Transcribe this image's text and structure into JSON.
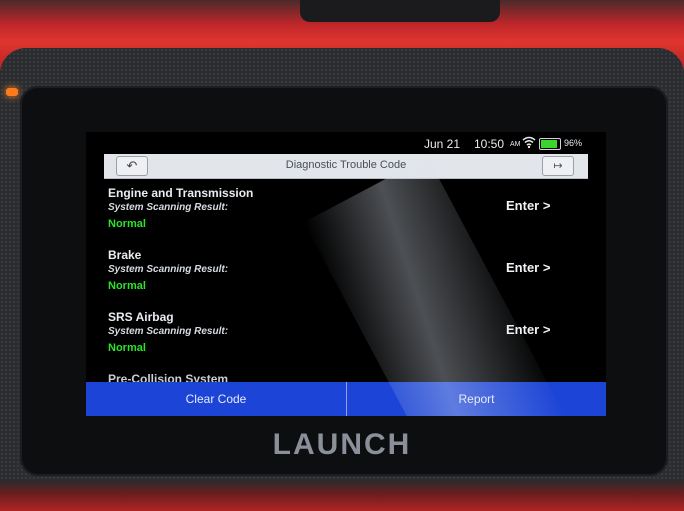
{
  "status_bar": {
    "date": "Jun 21",
    "time": "10:50",
    "ampm": "AM",
    "battery": "96%",
    "wifi_icon": "wifi-icon",
    "battery_level": 0.96,
    "battery_color": "#3ad52d"
  },
  "header": {
    "title": "Diagnostic Trouble Code",
    "back_icon": "back-arrow-icon",
    "exit_icon": "exit-icon"
  },
  "systems": [
    {
      "name": "Engine and Transmission",
      "subtitle": "System Scanning Result:",
      "status": "Normal",
      "action": "Enter >"
    },
    {
      "name": "Brake",
      "subtitle": "System Scanning Result:",
      "status": "Normal",
      "action": "Enter >"
    },
    {
      "name": "SRS Airbag",
      "subtitle": "System Scanning Result:",
      "status": "Normal",
      "action": "Enter >"
    },
    {
      "name": "Pre-Collision System"
    }
  ],
  "footer": {
    "clear_code": "Clear Code",
    "report": "Report"
  },
  "device": {
    "brand": "LAUNCH"
  },
  "colors": {
    "accent_blue": "#1c44d6",
    "status_green": "#2ee22a",
    "device_red": "#e0352f"
  }
}
